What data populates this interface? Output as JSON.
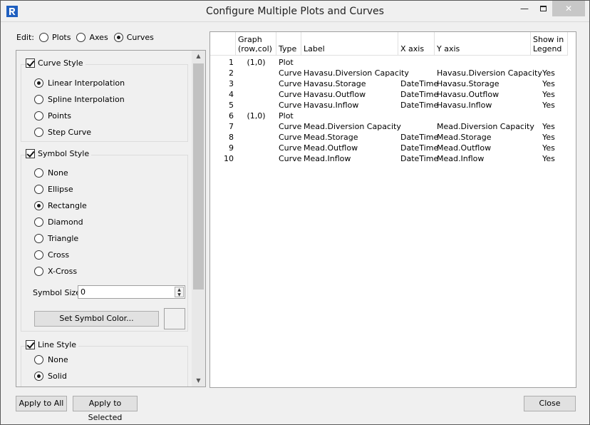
{
  "window": {
    "title": "Configure Multiple Plots and Curves"
  },
  "edit": {
    "label": "Edit:",
    "options": [
      "Plots",
      "Axes",
      "Curves"
    ],
    "selected": "Curves"
  },
  "curve_style": {
    "title": "Curve Style",
    "checked": true,
    "options": [
      "Linear Interpolation",
      "Spline Interpolation",
      "Points",
      "Step Curve"
    ],
    "selected": "Linear Interpolation"
  },
  "symbol_style": {
    "title": "Symbol Style",
    "checked": true,
    "options": [
      "None",
      "Ellipse",
      "Rectangle",
      "Diamond",
      "Triangle",
      "Cross",
      "X-Cross"
    ],
    "selected": "Rectangle",
    "size_label": "Symbol Size",
    "size_value": "0",
    "color_button": "Set Symbol Color..."
  },
  "line_style": {
    "title": "Line Style",
    "checked": true,
    "options": [
      "None",
      "Solid"
    ],
    "selected": "Solid"
  },
  "table": {
    "headers": {
      "graph": "Graph (row,col)",
      "type": "Type",
      "label": "Label",
      "xaxis": "X axis",
      "yaxis": "Y axis",
      "legend": "Show in Legend"
    },
    "rows": [
      {
        "n": "1",
        "graph": "(1,0)",
        "type": "Plot",
        "label": "",
        "x": "",
        "y": "",
        "legend": ""
      },
      {
        "n": "2",
        "graph": "",
        "type": "Curve",
        "label": "Havasu.Diversion Capacity",
        "x": "",
        "y": "Havasu.Diversion Capacity",
        "legend": "Yes"
      },
      {
        "n": "3",
        "graph": "",
        "type": "Curve",
        "label": "Havasu.Storage",
        "x": "DateTime",
        "y": "Havasu.Storage",
        "legend": "Yes"
      },
      {
        "n": "4",
        "graph": "",
        "type": "Curve",
        "label": "Havasu.Outflow",
        "x": "DateTime",
        "y": "Havasu.Outflow",
        "legend": "Yes"
      },
      {
        "n": "5",
        "graph": "",
        "type": "Curve",
        "label": "Havasu.Inflow",
        "x": "DateTime",
        "y": "Havasu.Inflow",
        "legend": "Yes"
      },
      {
        "n": "6",
        "graph": "(1,0)",
        "type": "Plot",
        "label": "",
        "x": "",
        "y": "",
        "legend": ""
      },
      {
        "n": "7",
        "graph": "",
        "type": "Curve",
        "label": "Mead.Diversion Capacity",
        "x": "",
        "y": "Mead.Diversion Capacity",
        "legend": "Yes"
      },
      {
        "n": "8",
        "graph": "",
        "type": "Curve",
        "label": "Mead.Storage",
        "x": "DateTime",
        "y": "Mead.Storage",
        "legend": "Yes"
      },
      {
        "n": "9",
        "graph": "",
        "type": "Curve",
        "label": "Mead.Outflow",
        "x": "DateTime",
        "y": "Mead.Outflow",
        "legend": "Yes"
      },
      {
        "n": "10",
        "graph": "",
        "type": "Curve",
        "label": "Mead.Inflow",
        "x": "DateTime",
        "y": "Mead.Inflow",
        "legend": "Yes"
      }
    ]
  },
  "buttons": {
    "apply_all": "Apply to All",
    "apply_selected": "Apply to Selected",
    "close": "Close"
  },
  "colors": {
    "app_icon": "#1f5fbf",
    "close_button": "#c7c7c7"
  }
}
